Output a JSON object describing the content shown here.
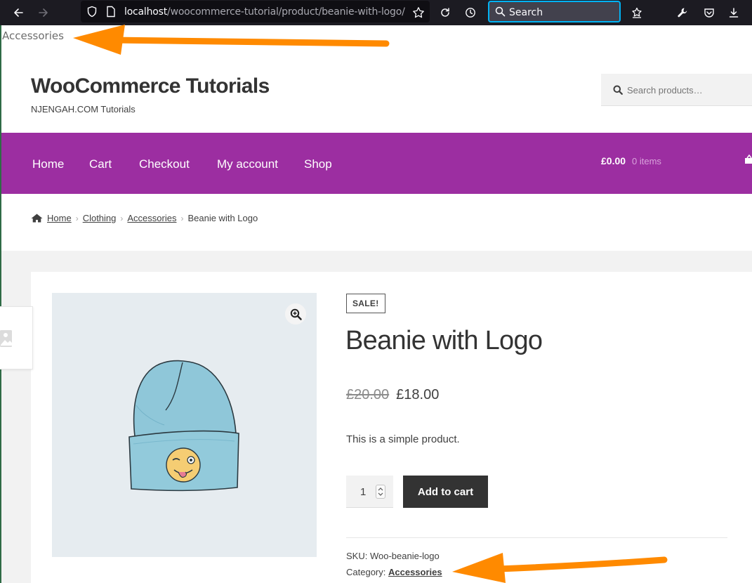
{
  "browser": {
    "url_host": "localhost",
    "url_path": "/woocommerce-tutorial/product/beanie-with-logo/",
    "search_placeholder": "Search"
  },
  "top_category_label": "Accessories",
  "site": {
    "title": "WooCommerce Tutorials",
    "tagline": "NJENGAH.COM Tutorials",
    "search_placeholder": "Search products…"
  },
  "nav": {
    "items": [
      "Home",
      "Cart",
      "Checkout",
      "My account",
      "Shop"
    ],
    "cart_amount": "£0.00",
    "cart_items": "0 items"
  },
  "breadcrumb": [
    "Home",
    "Clothing",
    "Accessories",
    "Beanie with Logo"
  ],
  "product": {
    "badge": "SALE!",
    "title": "Beanie with Logo",
    "regular_price": "£20.00",
    "sale_price": "£18.00",
    "short_description": "This is a simple product.",
    "quantity": "1",
    "add_to_cart": "Add to cart",
    "sku_label": "SKU:",
    "sku": "Woo-beanie-logo",
    "category_label": "Category:",
    "category": "Accessories"
  },
  "colors": {
    "nav_bg": "#9c2ea1",
    "button_bg": "#333333",
    "annotation_arrow": "#ff8a00",
    "browser_accent": "#00b3f4"
  }
}
